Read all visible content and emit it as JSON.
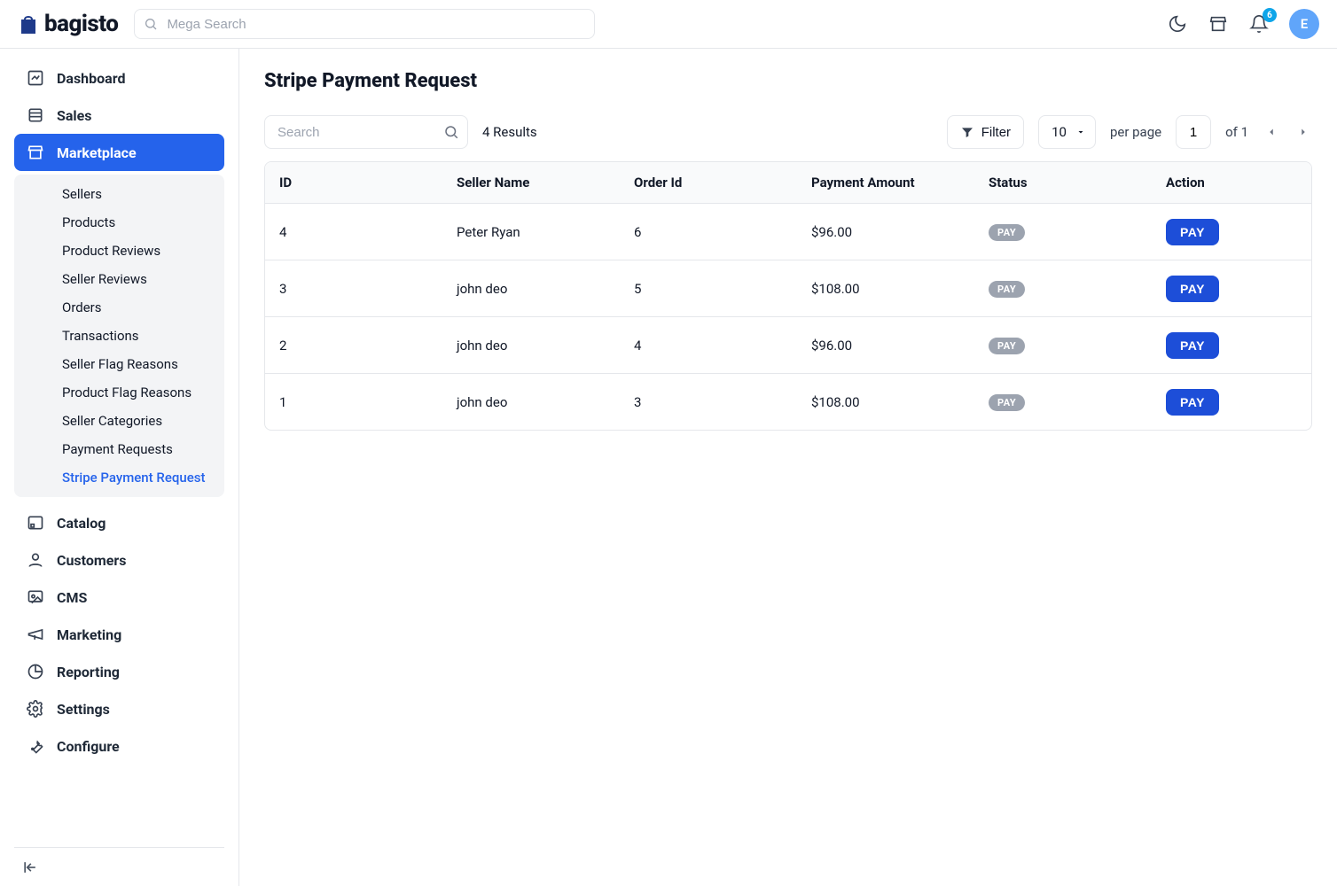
{
  "brand": "bagisto",
  "header": {
    "search_placeholder": "Mega Search",
    "notification_count": "6",
    "avatar_initial": "E"
  },
  "sidebar": {
    "items": [
      {
        "label": "Dashboard"
      },
      {
        "label": "Sales"
      },
      {
        "label": "Marketplace"
      },
      {
        "label": "Catalog"
      },
      {
        "label": "Customers"
      },
      {
        "label": "CMS"
      },
      {
        "label": "Marketing"
      },
      {
        "label": "Reporting"
      },
      {
        "label": "Settings"
      },
      {
        "label": "Configure"
      }
    ],
    "marketplace_sub": [
      {
        "label": "Sellers"
      },
      {
        "label": "Products"
      },
      {
        "label": "Product Reviews"
      },
      {
        "label": "Seller Reviews"
      },
      {
        "label": "Orders"
      },
      {
        "label": "Transactions"
      },
      {
        "label": "Seller Flag Reasons"
      },
      {
        "label": "Product Flag Reasons"
      },
      {
        "label": "Seller Categories"
      },
      {
        "label": "Payment Requests"
      },
      {
        "label": "Stripe Payment Request"
      }
    ]
  },
  "page": {
    "title": "Stripe Payment Request",
    "search_placeholder": "Search",
    "results_text": "4 Results",
    "filter_label": "Filter",
    "page_size": "10",
    "per_page_label": "per page",
    "page_input": "1",
    "of_text": "of 1"
  },
  "table": {
    "columns": [
      "ID",
      "Seller Name",
      "Order Id",
      "Payment Amount",
      "Status",
      "Action"
    ],
    "status_pill": "PAY",
    "action_button": "PAY",
    "rows": [
      {
        "id": "4",
        "seller": "Peter Ryan",
        "order": "6",
        "amount": "$96.00"
      },
      {
        "id": "3",
        "seller": "john deo",
        "order": "5",
        "amount": "$108.00"
      },
      {
        "id": "2",
        "seller": "john deo",
        "order": "4",
        "amount": "$96.00"
      },
      {
        "id": "1",
        "seller": "john deo",
        "order": "3",
        "amount": "$108.00"
      }
    ]
  }
}
